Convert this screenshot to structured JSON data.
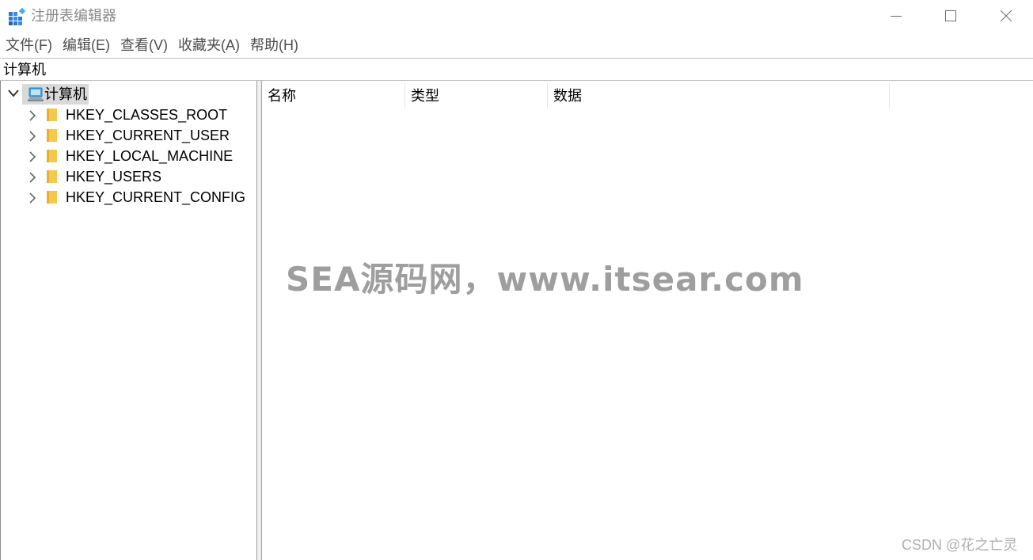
{
  "window": {
    "title": "注册表编辑器",
    "icon": "registry-editor-icon"
  },
  "menu": {
    "items": [
      {
        "label": "文件(F)"
      },
      {
        "label": "编辑(E)"
      },
      {
        "label": "查看(V)"
      },
      {
        "label": "收藏夹(A)"
      },
      {
        "label": "帮助(H)"
      }
    ]
  },
  "address": {
    "path": "计算机"
  },
  "tree": {
    "root": {
      "label": "计算机",
      "icon": "computer-icon",
      "expanded": true
    },
    "nodes": [
      {
        "label": "HKEY_CLASSES_ROOT",
        "icon": "folder-icon"
      },
      {
        "label": "HKEY_CURRENT_USER",
        "icon": "folder-icon"
      },
      {
        "label": "HKEY_LOCAL_MACHINE",
        "icon": "folder-icon"
      },
      {
        "label": "HKEY_USERS",
        "icon": "folder-icon"
      },
      {
        "label": "HKEY_CURRENT_CONFIG",
        "icon": "folder-icon"
      }
    ]
  },
  "list": {
    "columns": {
      "name": "名称",
      "type": "类型",
      "data": "数据"
    }
  },
  "overlays": {
    "watermark": "SEA源码网，www.itsear.com",
    "credit": "CSDN @花之亡灵"
  },
  "colors": {
    "folder": "#f5c84c",
    "selection": "#d9d9d9",
    "title_text": "#8a8a8a"
  }
}
